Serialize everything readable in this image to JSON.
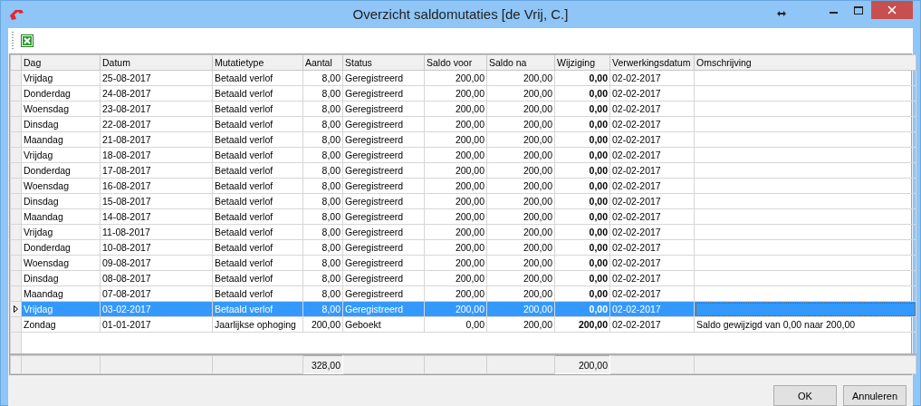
{
  "window": {
    "title": "Overzicht saldomutaties [de Vrij, C.]"
  },
  "table": {
    "columns": [
      {
        "label": "Dag",
        "kind": "text"
      },
      {
        "label": "Datum",
        "kind": "text"
      },
      {
        "label": "Mutatietype",
        "kind": "text"
      },
      {
        "label": "Aantal",
        "kind": "number",
        "total": "328,00"
      },
      {
        "label": "Status",
        "kind": "text"
      },
      {
        "label": "Saldo voor",
        "kind": "number"
      },
      {
        "label": "Saldo na",
        "kind": "number"
      },
      {
        "label": "Wijziging",
        "kind": "bold",
        "total": "200,00"
      },
      {
        "label": "Verwerkingsdatum",
        "kind": "text"
      },
      {
        "label": "Omschrijving",
        "kind": "text"
      }
    ],
    "rows": [
      {
        "selected": false,
        "cells": [
          "Vrijdag",
          "25-08-2017",
          "Betaald verlof",
          "8,00",
          "Geregistreerd",
          "200,00",
          "200,00",
          "0,00",
          "02-02-2017",
          ""
        ]
      },
      {
        "selected": false,
        "cells": [
          "Donderdag",
          "24-08-2017",
          "Betaald verlof",
          "8,00",
          "Geregistreerd",
          "200,00",
          "200,00",
          "0,00",
          "02-02-2017",
          ""
        ]
      },
      {
        "selected": false,
        "cells": [
          "Woensdag",
          "23-08-2017",
          "Betaald verlof",
          "8,00",
          "Geregistreerd",
          "200,00",
          "200,00",
          "0,00",
          "02-02-2017",
          ""
        ]
      },
      {
        "selected": false,
        "cells": [
          "Dinsdag",
          "22-08-2017",
          "Betaald verlof",
          "8,00",
          "Geregistreerd",
          "200,00",
          "200,00",
          "0,00",
          "02-02-2017",
          ""
        ]
      },
      {
        "selected": false,
        "cells": [
          "Maandag",
          "21-08-2017",
          "Betaald verlof",
          "8,00",
          "Geregistreerd",
          "200,00",
          "200,00",
          "0,00",
          "02-02-2017",
          ""
        ]
      },
      {
        "selected": false,
        "cells": [
          "Vrijdag",
          "18-08-2017",
          "Betaald verlof",
          "8,00",
          "Geregistreerd",
          "200,00",
          "200,00",
          "0,00",
          "02-02-2017",
          ""
        ]
      },
      {
        "selected": false,
        "cells": [
          "Donderdag",
          "17-08-2017",
          "Betaald verlof",
          "8,00",
          "Geregistreerd",
          "200,00",
          "200,00",
          "0,00",
          "02-02-2017",
          ""
        ]
      },
      {
        "selected": false,
        "cells": [
          "Woensdag",
          "16-08-2017",
          "Betaald verlof",
          "8,00",
          "Geregistreerd",
          "200,00",
          "200,00",
          "0,00",
          "02-02-2017",
          ""
        ]
      },
      {
        "selected": false,
        "cells": [
          "Dinsdag",
          "15-08-2017",
          "Betaald verlof",
          "8,00",
          "Geregistreerd",
          "200,00",
          "200,00",
          "0,00",
          "02-02-2017",
          ""
        ]
      },
      {
        "selected": false,
        "cells": [
          "Maandag",
          "14-08-2017",
          "Betaald verlof",
          "8,00",
          "Geregistreerd",
          "200,00",
          "200,00",
          "0,00",
          "02-02-2017",
          ""
        ]
      },
      {
        "selected": false,
        "cells": [
          "Vrijdag",
          "11-08-2017",
          "Betaald verlof",
          "8,00",
          "Geregistreerd",
          "200,00",
          "200,00",
          "0,00",
          "02-02-2017",
          ""
        ]
      },
      {
        "selected": false,
        "cells": [
          "Donderdag",
          "10-08-2017",
          "Betaald verlof",
          "8,00",
          "Geregistreerd",
          "200,00",
          "200,00",
          "0,00",
          "02-02-2017",
          ""
        ]
      },
      {
        "selected": false,
        "cells": [
          "Woensdag",
          "09-08-2017",
          "Betaald verlof",
          "8,00",
          "Geregistreerd",
          "200,00",
          "200,00",
          "0,00",
          "02-02-2017",
          ""
        ]
      },
      {
        "selected": false,
        "cells": [
          "Dinsdag",
          "08-08-2017",
          "Betaald verlof",
          "8,00",
          "Geregistreerd",
          "200,00",
          "200,00",
          "0,00",
          "02-02-2017",
          ""
        ]
      },
      {
        "selected": false,
        "cells": [
          "Maandag",
          "07-08-2017",
          "Betaald verlof",
          "8,00",
          "Geregistreerd",
          "200,00",
          "200,00",
          "0,00",
          "02-02-2017",
          ""
        ]
      },
      {
        "selected": true,
        "cells": [
          "Vrijdag",
          "03-02-2017",
          "Betaald verlof",
          "8,00",
          "Geregistreerd",
          "200,00",
          "200,00",
          "0,00",
          "02-02-2017",
          ""
        ]
      },
      {
        "selected": false,
        "cells": [
          "Zondag",
          "01-01-2017",
          "Jaarlijkse ophoging",
          "200,00",
          "Geboekt",
          "0,00",
          "200,00",
          "200,00",
          "02-02-2017",
          "Saldo gewijzigd van 0,00 naar  200,00"
        ]
      }
    ]
  },
  "buttons": [
    "OK",
    "Annuleren"
  ]
}
